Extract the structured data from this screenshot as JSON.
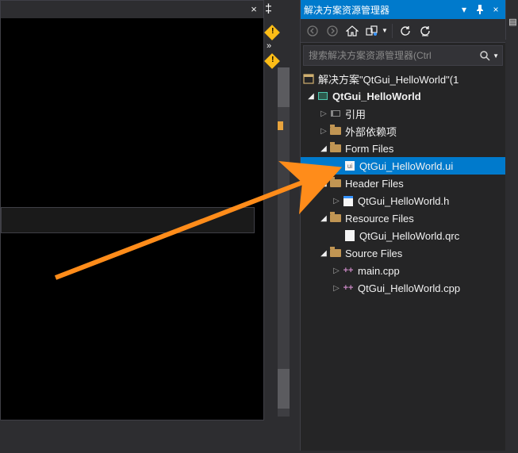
{
  "panel": {
    "title": "解决方案资源管理器",
    "search_placeholder": "搜索解决方案资源管理器(Ctrl"
  },
  "solution": {
    "label": "解决方案\"QtGui_HelloWorld\"(1 ",
    "project": "QtGui_HelloWorld",
    "references": "引用",
    "external": "外部依赖项",
    "form_folder": "Form Files",
    "form_file": "QtGui_HelloWorld.ui",
    "header_folder": "Header Files",
    "header_file": "QtGui_HelloWorld.h",
    "resource_folder": "Resource Files",
    "resource_file": "QtGui_HelloWorld.qrc",
    "source_folder": "Source Files",
    "source_file1": "main.cpp",
    "source_file2": "QtGui_HelloWorld.cpp",
    "ui_badge": "ui"
  }
}
